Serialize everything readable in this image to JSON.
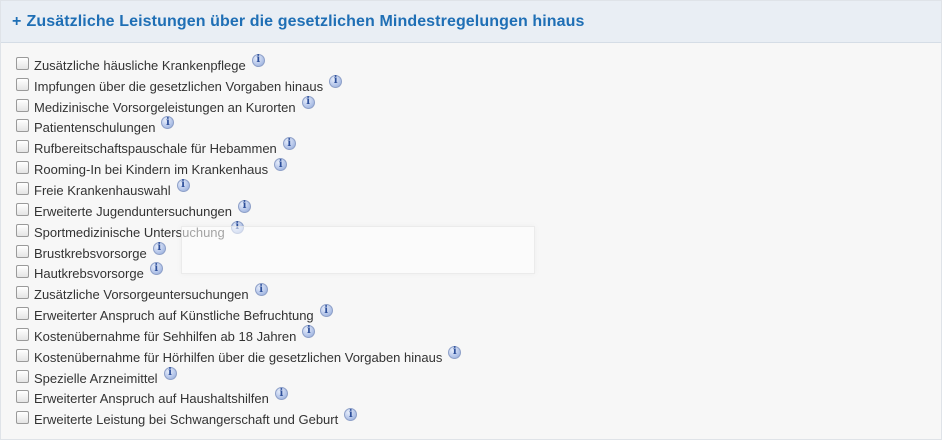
{
  "section": {
    "title": "Zusätzliche Leistungen über die gesetzlichen Mindestregelungen hinaus",
    "toggle_symbol": "+"
  },
  "icons": {
    "checkbox": "checkbox-icon",
    "info": "info-icon"
  },
  "colors": {
    "header_text": "#1f6fb5",
    "header_bg": "#e9eef4",
    "panel_bg": "#f7f7f7",
    "info_icon": "#8ea6d8"
  },
  "options": [
    {
      "label": "Zusätzliche häusliche Krankenpflege",
      "checked": false
    },
    {
      "label": "Impfungen über die gesetzlichen Vorgaben hinaus",
      "checked": false
    },
    {
      "label": "Medizinische Vorsorgeleistungen an Kurorten",
      "checked": false
    },
    {
      "label": "Patientenschulungen",
      "checked": false
    },
    {
      "label": "Rufbereitschaftspauschale für Hebammen",
      "checked": false
    },
    {
      "label": "Rooming-In bei Kindern im Krankenhaus",
      "checked": false
    },
    {
      "label": "Freie Krankenhauswahl",
      "checked": false
    },
    {
      "label": "Erweiterte Jugenduntersuchungen",
      "checked": false
    },
    {
      "label": "Sportmedizinische Untersuchung",
      "checked": false
    },
    {
      "label": "Brustkrebsvorsorge",
      "checked": false
    },
    {
      "label": "Hautkrebsvorsorge",
      "checked": false
    },
    {
      "label": "Zusätzliche Vorsorgeuntersuchungen",
      "checked": false
    },
    {
      "label": "Erweiterter Anspruch auf Künstliche Befruchtung",
      "checked": false
    },
    {
      "label": "Kostenübernahme für Sehhilfen ab 18 Jahren",
      "checked": false
    },
    {
      "label": "Kostenübernahme für Hörhilfen über die gesetzlichen Vorgaben hinaus",
      "checked": false
    },
    {
      "label": "Spezielle Arzneimittel",
      "checked": false
    },
    {
      "label": "Erweiterter Anspruch auf Haushaltshilfen",
      "checked": false
    },
    {
      "label": "Erweiterte Leistung bei Schwangerschaft und Geburt",
      "checked": false
    }
  ]
}
